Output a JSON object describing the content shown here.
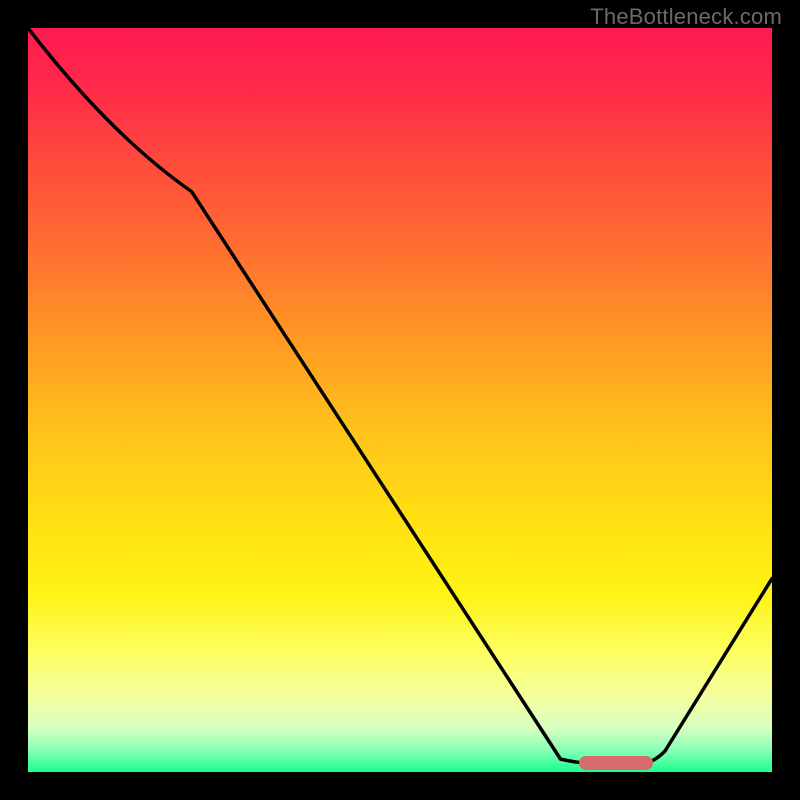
{
  "watermark": "TheBottleneck.com",
  "colors": {
    "frame_bg": "#000000",
    "marker": "#d86b6b",
    "curve": "#000000"
  },
  "chart_data": {
    "type": "line",
    "title": "",
    "xlabel": "",
    "ylabel": "",
    "xlim": [
      0,
      100
    ],
    "ylim": [
      0,
      100
    ],
    "x": [
      0,
      22,
      74,
      84,
      100
    ],
    "y": [
      100,
      78,
      2,
      2,
      26
    ],
    "marker": {
      "x_start": 74,
      "x_end": 84,
      "y": 1
    },
    "gradient_stops": [
      {
        "pct": 0,
        "color": "#ff1a52"
      },
      {
        "pct": 18,
        "color": "#ff4a3c"
      },
      {
        "pct": 42,
        "color": "#ff9a24"
      },
      {
        "pct": 66,
        "color": "#ffe012"
      },
      {
        "pct": 84,
        "color": "#fdff62"
      },
      {
        "pct": 94,
        "color": "#d9ffc0"
      },
      {
        "pct": 100,
        "color": "#19ff8c"
      }
    ]
  }
}
